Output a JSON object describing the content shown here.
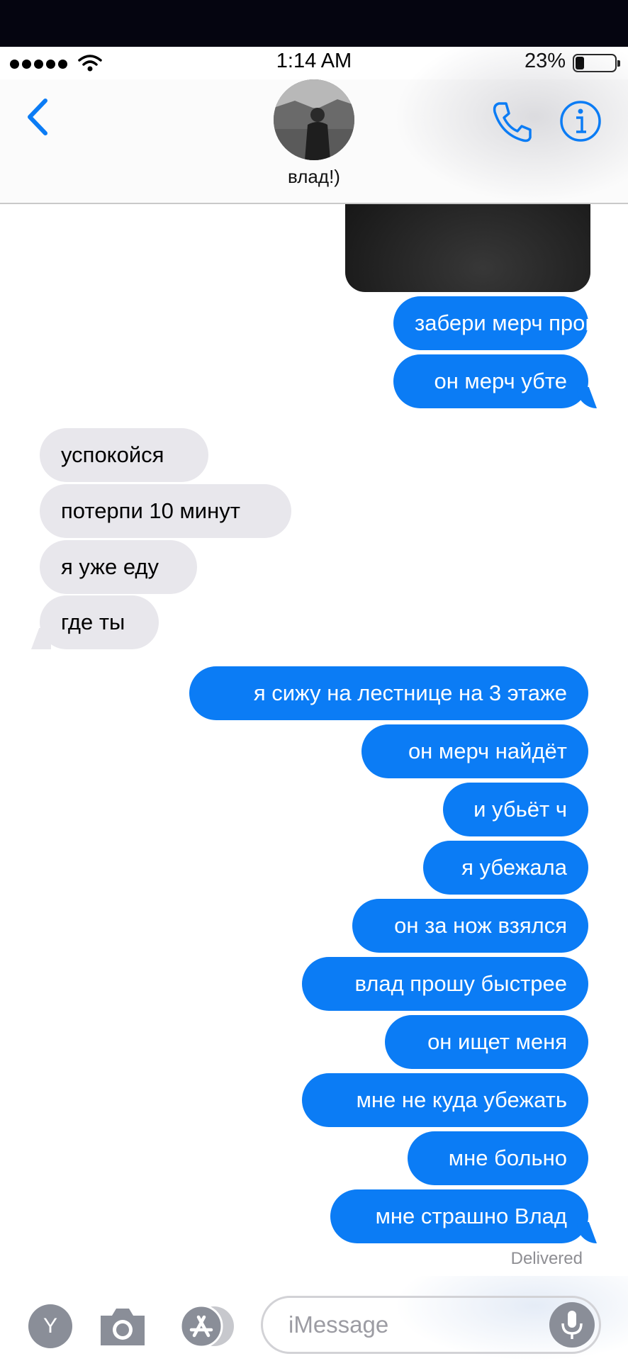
{
  "status_bar": {
    "time": "1:14 AM",
    "battery_percent": "23%",
    "battery_level": 0.23
  },
  "header": {
    "contact_name": "влад!)"
  },
  "messages": [
    {
      "id": "m1",
      "direction": "outgoing",
      "text": "забери мерч прошуч"
    },
    {
      "id": "m2",
      "direction": "outgoing",
      "text": "он мерч убте"
    },
    {
      "id": "m3",
      "direction": "incoming",
      "text": "успокойся"
    },
    {
      "id": "m4",
      "direction": "incoming",
      "text": "потерпи 10 минут"
    },
    {
      "id": "m5",
      "direction": "incoming",
      "text": "я уже еду"
    },
    {
      "id": "m6",
      "direction": "incoming",
      "text": "где ты"
    },
    {
      "id": "m7",
      "direction": "outgoing",
      "text": "я сижу на лестнице на 3 этаже"
    },
    {
      "id": "m8",
      "direction": "outgoing",
      "text": "он мерч найдёт"
    },
    {
      "id": "m9",
      "direction": "outgoing",
      "text": "и убьёт ч"
    },
    {
      "id": "m10",
      "direction": "outgoing",
      "text": "я убежала"
    },
    {
      "id": "m11",
      "direction": "outgoing",
      "text": "он за нож взялся"
    },
    {
      "id": "m12",
      "direction": "outgoing",
      "text": "влад прошу быстрее"
    },
    {
      "id": "m13",
      "direction": "outgoing",
      "text": "он ищет меня"
    },
    {
      "id": "m14",
      "direction": "outgoing",
      "text": "мне не куда убежать"
    },
    {
      "id": "m15",
      "direction": "outgoing",
      "text": "мне больно"
    },
    {
      "id": "m16",
      "direction": "outgoing",
      "text": "мне страшно Влад"
    }
  ],
  "delivered_label": "Delivered",
  "input_bar": {
    "placeholder": "iMessage",
    "app_icon_letter": "Y"
  },
  "colors": {
    "accent": "#0b7cf5",
    "incoming_bubble": "#e8e7ec",
    "status_gray": "#8e8e93"
  },
  "icons": [
    "back-chevron-icon",
    "phone-icon",
    "info-icon",
    "camera-icon",
    "app-store-icon",
    "microphone-icon",
    "wifi-icon"
  ]
}
